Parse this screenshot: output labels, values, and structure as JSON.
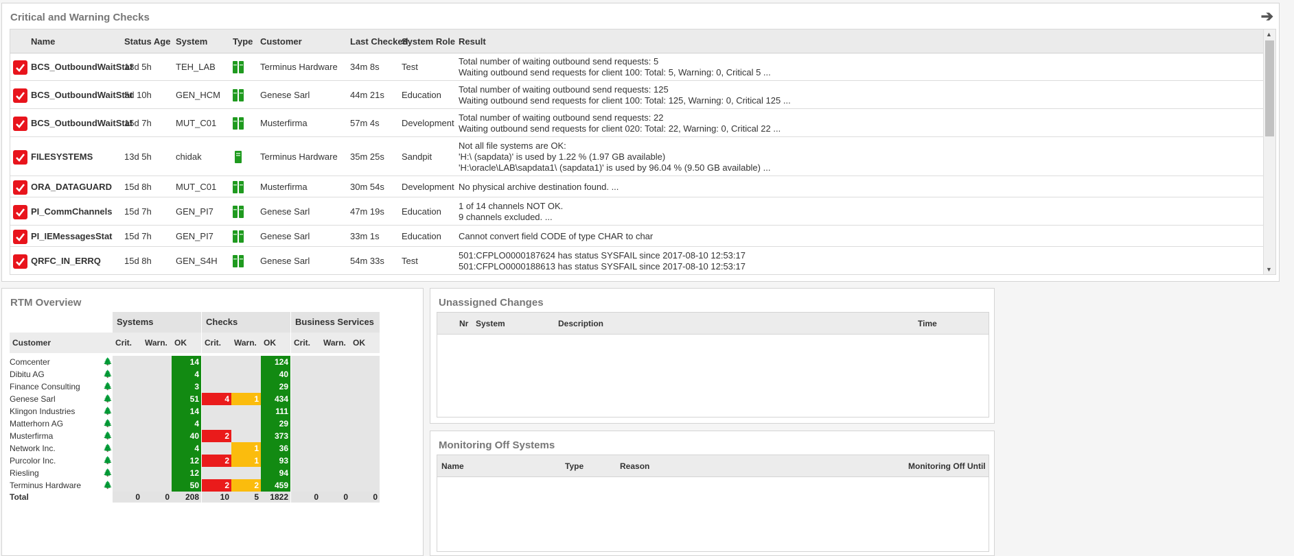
{
  "critical": {
    "title": "Critical and Warning Checks",
    "columns": [
      "Name",
      "Status Age",
      "System",
      "Type",
      "Customer",
      "Last Checked",
      "System Role",
      "Result"
    ],
    "rows": [
      {
        "name": "BCS_OutboundWaitStat",
        "age": "13d 5h",
        "system": "TEH_LAB",
        "customer": "Terminus Hardware",
        "last": "34m 8s",
        "role": "Test",
        "result": [
          "Total number of waiting outbound send requests: 5",
          "Waiting outbound send requests for client 100: Total: 5, Warning: 0, Critical 5 ..."
        ],
        "type": "multi"
      },
      {
        "name": "BCS_OutboundWaitStat",
        "age": "5d 10h",
        "system": "GEN_HCM",
        "customer": "Genese Sarl",
        "last": "44m 21s",
        "role": "Education",
        "result": [
          "Total number of waiting outbound send requests: 125",
          "Waiting outbound send requests for client 100: Total: 125, Warning: 0, Critical 125 ..."
        ],
        "type": "multi"
      },
      {
        "name": "BCS_OutboundWaitStat",
        "age": "15d 7h",
        "system": "MUT_C01",
        "customer": "Musterfirma",
        "last": "57m 4s",
        "role": "Development",
        "result": [
          "Total number of waiting outbound send requests: 22",
          "Waiting outbound send requests for client 020: Total: 22, Warning: 0, Critical 22 ..."
        ],
        "type": "multi"
      },
      {
        "name": "FILESYSTEMS",
        "age": "13d 5h",
        "system": "chidak",
        "customer": "Terminus Hardware",
        "last": "35m 25s",
        "role": "Sandpit",
        "result": [
          "Not all file systems are OK:",
          "'H:\\ (sapdata)' is used by 1.22 % (1.97 GB available)",
          "'H:\\oracle\\LAB\\sapdata1\\ (sapdata1)' is used by 96.04 % (9.50 GB available) ..."
        ],
        "type": "single"
      },
      {
        "name": "ORA_DATAGUARD",
        "age": "15d 8h",
        "system": "MUT_C01",
        "customer": "Musterfirma",
        "last": "30m 54s",
        "role": "Development",
        "result": [
          "No physical archive destination found. ..."
        ],
        "type": "multi"
      },
      {
        "name": "PI_CommChannels",
        "age": "15d 7h",
        "system": "GEN_PI7",
        "customer": "Genese Sarl",
        "last": "47m 19s",
        "role": "Education",
        "result": [
          "1 of 14 channels NOT OK.",
          "9 channels excluded. ..."
        ],
        "type": "multi"
      },
      {
        "name": "PI_IEMessagesStat",
        "age": "15d 7h",
        "system": "GEN_PI7",
        "customer": "Genese Sarl",
        "last": "33m 1s",
        "role": "Education",
        "result": [
          "Cannot convert field CODE of type CHAR to char"
        ],
        "type": "multi"
      },
      {
        "name": "QRFC_IN_ERRQ",
        "age": "15d 8h",
        "system": "GEN_S4H",
        "customer": "Genese Sarl",
        "last": "54m 33s",
        "role": "Test",
        "result": [
          "501:CFPLO0000187624 has status SYSFAIL since 2017-08-10 12:53:17",
          "501:CFPLO0000188613 has status SYSFAIL since 2017-08-10 12:53:17"
        ],
        "type": "multi"
      }
    ]
  },
  "rtm": {
    "title": "RTM Overview",
    "groups": [
      "Systems",
      "Checks",
      "Business Services"
    ],
    "customer_header": "Customer",
    "sub_headers": [
      "Crit.",
      "Warn.",
      "OK"
    ],
    "customers": [
      {
        "name": "Comcenter",
        "sys_ok": "14",
        "chk_crit": "",
        "chk_warn": "",
        "chk_ok": "124"
      },
      {
        "name": "Dibitu AG",
        "sys_ok": "4",
        "chk_crit": "",
        "chk_warn": "",
        "chk_ok": "40"
      },
      {
        "name": "Finance Consulting",
        "sys_ok": "3",
        "chk_crit": "",
        "chk_warn": "",
        "chk_ok": "29"
      },
      {
        "name": "Genese Sarl",
        "sys_ok": "51",
        "chk_crit": "4",
        "chk_warn": "1",
        "chk_ok": "434"
      },
      {
        "name": "Klingon Industries",
        "sys_ok": "14",
        "chk_crit": "",
        "chk_warn": "",
        "chk_ok": "111"
      },
      {
        "name": "Matterhorn AG",
        "sys_ok": "4",
        "chk_crit": "",
        "chk_warn": "",
        "chk_ok": "29"
      },
      {
        "name": "Musterfirma",
        "sys_ok": "40",
        "chk_crit": "2",
        "chk_warn": "",
        "chk_ok": "373"
      },
      {
        "name": "Network Inc.",
        "sys_ok": "4",
        "chk_crit": "",
        "chk_warn": "1",
        "chk_ok": "36"
      },
      {
        "name": "Purcolor Inc.",
        "sys_ok": "12",
        "chk_crit": "2",
        "chk_warn": "1",
        "chk_ok": "93"
      },
      {
        "name": "Riesling",
        "sys_ok": "12",
        "chk_crit": "",
        "chk_warn": "",
        "chk_ok": "94"
      },
      {
        "name": "Terminus Hardware",
        "sys_ok": "50",
        "chk_crit": "2",
        "chk_warn": "2",
        "chk_ok": "459"
      }
    ],
    "total": {
      "label": "Total",
      "values": [
        "0",
        "0",
        "208",
        "10",
        "5",
        "1822",
        "0",
        "0",
        "0"
      ]
    }
  },
  "changes": {
    "title": "Unassigned Changes",
    "columns": [
      "Nr",
      "System",
      "Description",
      "Time"
    ]
  },
  "monoff": {
    "title": "Monitoring Off Systems",
    "columns": [
      "Name",
      "Type",
      "Reason",
      "Monitoring Off Until"
    ]
  },
  "colors": {
    "crit": "#ea1b1b",
    "warn": "#fbbc0d",
    "ok": "#128a12",
    "check": "#e8141c"
  }
}
